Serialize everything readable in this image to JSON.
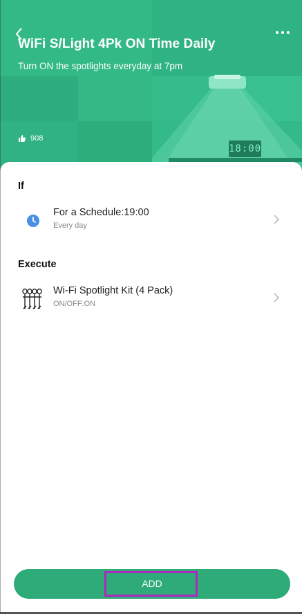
{
  "header": {
    "title": "WiFi S/Light 4Pk ON Time Daily",
    "subtitle": "Turn ON the spotlights everyday at 7pm",
    "likes": "908",
    "display_time": "18:00",
    "accent": "#2fb380"
  },
  "sections": {
    "if_title": "If",
    "execute_title": "Execute"
  },
  "condition": {
    "title": "For a Schedule:19:00",
    "detail": "Every day",
    "icon": "clock-icon"
  },
  "action": {
    "title": "Wi-Fi Spotlight Kit (4 Pack)",
    "detail": "ON/OFF:ON",
    "icon": "spotlight-kit-icon"
  },
  "footer": {
    "add_label": "ADD",
    "button_color": "#2faa79",
    "highlight_color": "#b026c0"
  }
}
